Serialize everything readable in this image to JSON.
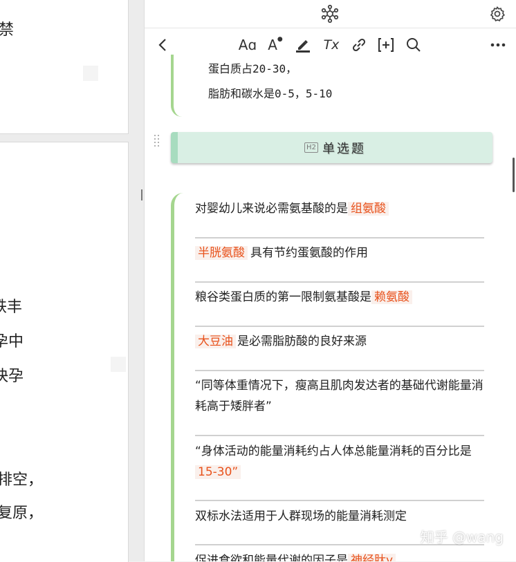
{
  "left_document": {
    "page1_fragments": [
      "禁"
    ],
    "page2_fragments": [
      "铁丰",
      "孕中",
      "快孕",
      "排空，",
      "复原，"
    ]
  },
  "toolbar": {
    "back": "chevron-left-icon",
    "font_style": "Aɑ",
    "font_color": "A",
    "highlight": "highlighter-icon",
    "clear_format": "Tx",
    "link": "link-icon",
    "insert_block": "add-block-icon",
    "search": "search-icon",
    "more": "more-icon"
  },
  "topbar": {
    "graph": "graph-icon",
    "settings": "gear-icon"
  },
  "note": {
    "prev_lines": [
      "蛋白质占20-30，",
      "脂肪和碳水是0-5，5-10"
    ],
    "heading": {
      "level": "H2",
      "text": "单选题"
    },
    "items": [
      {
        "pre": "对婴幼儿来说必需氨基酸的是",
        "hl": "组氨酸",
        "post": ""
      },
      {
        "pre": "",
        "hl": "半胱氨酸",
        "post": "具有节约蛋氨酸的作用"
      },
      {
        "pre": "粮谷类蛋白质的第一限制氨基酸是",
        "hl": "赖氨酸",
        "post": ""
      },
      {
        "pre": "",
        "hl": "大豆油",
        "post": "是必需脂肪酸的良好来源"
      },
      {
        "pre": "“同等体重情况下，瘦高且肌肉发达者的基础代谢能量消耗高于矮胖者”",
        "hl": "",
        "post": ""
      },
      {
        "pre": "“身体活动的能量消耗约占人体总能量消耗的百分比是",
        "hl": "15-30”",
        "post": ""
      },
      {
        "pre": "双标水法适用于人群现场的能量消耗测定",
        "hl": "",
        "post": ""
      },
      {
        "pre": "促进食欲和能量代谢的因子是",
        "hl": "神经肽y",
        "post": ""
      }
    ]
  },
  "watermark": "知乎 @wang",
  "colors": {
    "accent_green": "#a5d68f",
    "heading_bg": "#d9efe4",
    "highlight_text": "#e8521c",
    "highlight_bg": "#faf0ec"
  }
}
